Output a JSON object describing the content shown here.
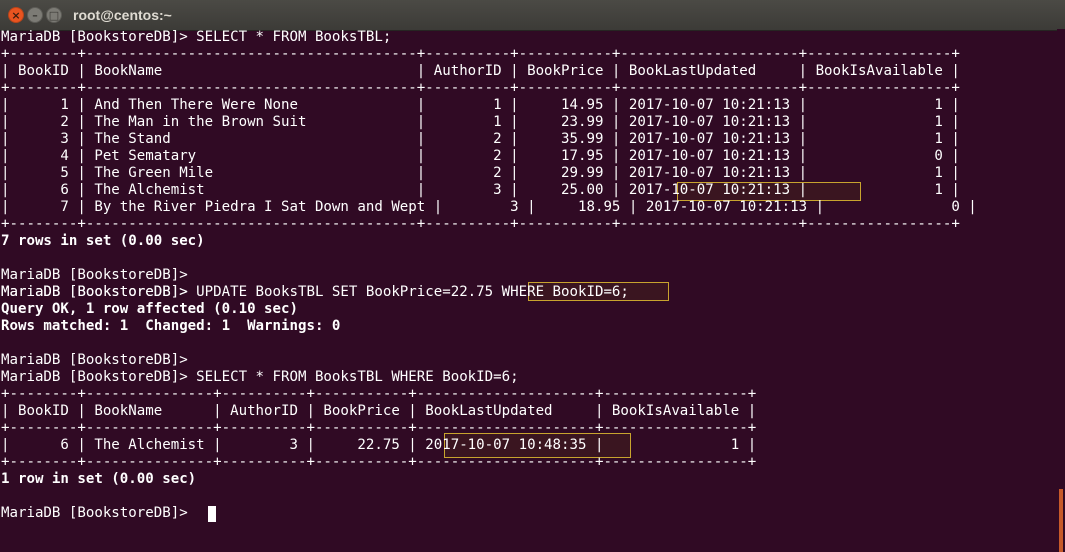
{
  "window": {
    "title": "root@centos:~",
    "close_icon": "×",
    "minimize_icon": "–",
    "maximize_icon": "□"
  },
  "colors": {
    "background": "#300a24",
    "text": "#ffffff",
    "highlight_border": "#c8a42e"
  },
  "terminal": {
    "lines": [
      {
        "text": "MariaDB [BookstoreDB]> SELECT * FROM BooksTBL;"
      },
      {
        "text": "+--------+---------------------------------------+----------+-----------+---------------------+-----------------+"
      },
      {
        "text": "| BookID | BookName                              | AuthorID | BookPrice | BookLastUpdated     | BookIsAvailable |"
      },
      {
        "text": "+--------+---------------------------------------+----------+-----------+---------------------+-----------------+"
      },
      {
        "text": "|      1 | And Then There Were None              |        1 |     14.95 | 2017-10-07 10:21:13 |               1 |"
      },
      {
        "text": "|      2 | The Man in the Brown Suit             |        1 |     23.99 | 2017-10-07 10:21:13 |               1 |"
      },
      {
        "text": "|      3 | The Stand                             |        2 |     35.99 | 2017-10-07 10:21:13 |               1 |"
      },
      {
        "text": "|      4 | Pet Sematary                          |        2 |     17.95 | 2017-10-07 10:21:13 |               0 |"
      },
      {
        "text": "|      5 | The Green Mile                        |        2 |     29.99 | 2017-10-07 10:21:13 |               1 |"
      },
      {
        "text": "|      6 | The Alchemist                         |        3 |     25.00 | 2017-10-07 10:21:13 |               1 |"
      },
      {
        "text": "|      7 | By the River Piedra I Sat Down and Wept |        3 |     18.95 | 2017-10-07 10:21:13 |               0 |"
      },
      {
        "text": "+--------+---------------------------------------+----------+-----------+---------------------+-----------------+"
      },
      {
        "text": "7 rows in set (0.00 sec)"
      },
      {
        "text": ""
      },
      {
        "text": "MariaDB [BookstoreDB]>"
      },
      {
        "text": "MariaDB [BookstoreDB]>"
      },
      {
        "text": "MariaDB [BookstoreDB]> UPDATE BooksTBL SET BookPrice=22.75 WHERE BookID=6;"
      },
      {
        "text": "Query OK, 1 row affected (0.10 sec)"
      },
      {
        "text": "Rows matched: 1  Changed: 1  Warnings: 0"
      },
      {
        "text": ""
      },
      {
        "text": "MariaDB [BookstoreDB]>"
      },
      {
        "text": "MariaDB [BookstoreDB]> SELECT * FROM BooksTBL WHERE BookID=6;"
      },
      {
        "text": "+--------+---------------+----------+-----------+---------------------+-----------------+"
      },
      {
        "text": "| BookID | BookName      | AuthorID | BookPrice | BookLastUpdated     | BookIsAvailable |"
      },
      {
        "text": "+--------+---------------+----------+-----------+---------------------+-----------------+"
      },
      {
        "text": "|      6 | The Alchemist |        3 |     22.75 | 2017-10-07 10:48:35 |               1 |"
      },
      {
        "text": "+--------+---------------+----------+-----------+---------------------+-----------------+"
      },
      {
        "text": "1 row in set (0.00 sec)"
      },
      {
        "text": ""
      },
      {
        "text": "MariaDB [BookstoreDB]>"
      }
    ]
  }
}
